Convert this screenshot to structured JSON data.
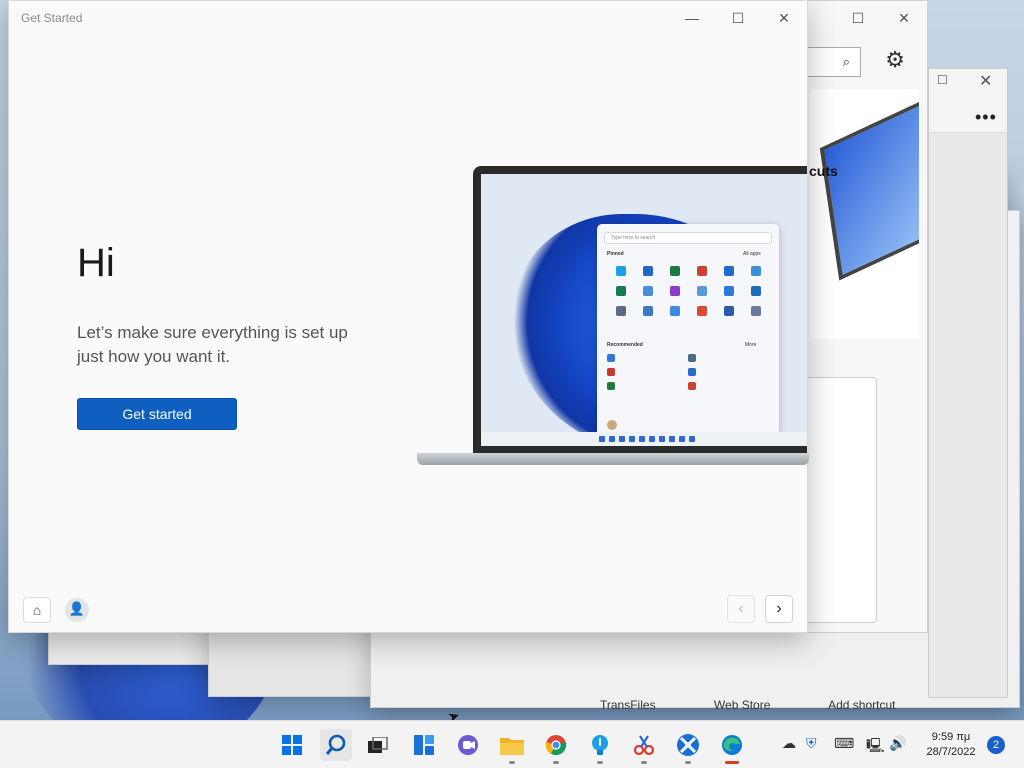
{
  "window": {
    "title": "Get Started",
    "heading": "Hi",
    "subtitle": "Let’s make sure everything is set up just how you want it.",
    "cta_label": "Get started"
  },
  "background_strip": {
    "items": [
      "TransFiles",
      "Web Store",
      "Add shortcut"
    ]
  },
  "store_window": {
    "partial_text": "cuts"
  },
  "laptop_startmenu": {
    "search_placeholder": "Type here to search",
    "pinned_label": "Pinned",
    "all_apps_label": "All apps",
    "recommended_label": "Recommended",
    "more_label": "More"
  },
  "taskbar": {
    "apps": [
      "start-menu",
      "search",
      "task-view",
      "widgets",
      "chat",
      "file-explorer",
      "chrome",
      "lightbulb-app",
      "snip-tool",
      "vpn-app",
      "edge"
    ],
    "clock_time": "9:59 πμ",
    "clock_date": "28/7/2022",
    "notification_count": "2"
  },
  "colors": {
    "accent": "#0f5fc0",
    "taskbar_bg": "#f3f3f3"
  }
}
